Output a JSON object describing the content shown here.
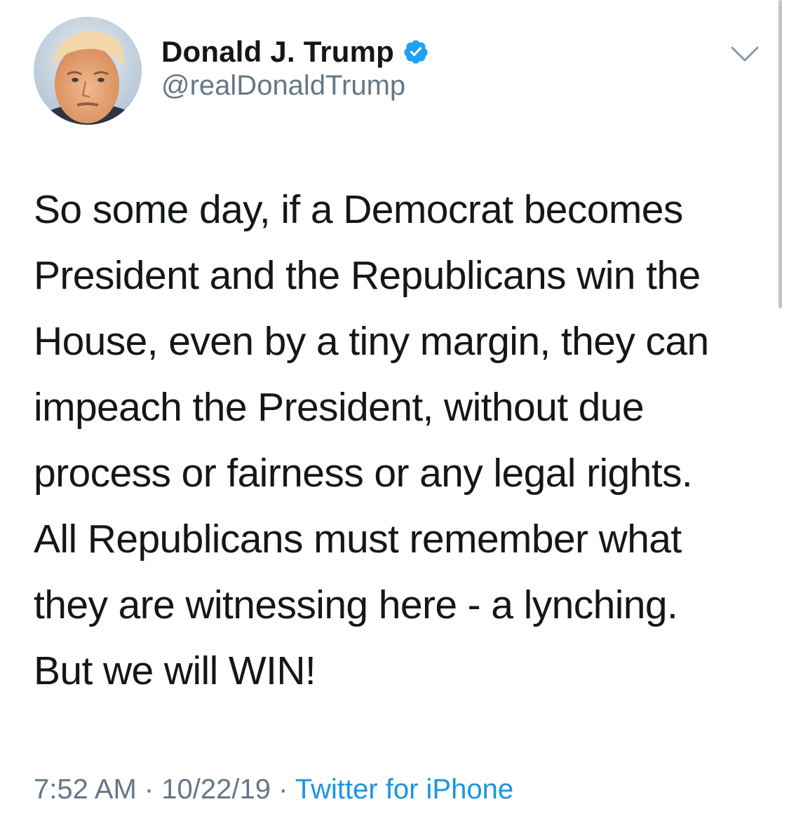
{
  "author": {
    "display_name": "Donald J. Trump",
    "handle": "@realDonaldTrump",
    "verified": true
  },
  "tweet": {
    "text": "So some day, if a Democrat becomes\nPresident and the Republicans win the\nHouse, even by a tiny margin, they can\nimpeach the President, without due\nprocess or fairness or any legal rights.\nAll Republicans must remember what\nthey are witnessing here - a lynching.\nBut we will WIN!"
  },
  "meta": {
    "time": "7:52 AM",
    "separator": " · ",
    "date": "10/22/19",
    "source": "Twitter for iPhone"
  },
  "icons": {
    "verified": "verified-badge-icon",
    "menu": "chevron-down-icon"
  },
  "colors": {
    "verified_blue": "#1da1f2",
    "link_blue": "#1b95e0",
    "secondary_gray": "#657786",
    "text": "#14171a"
  }
}
